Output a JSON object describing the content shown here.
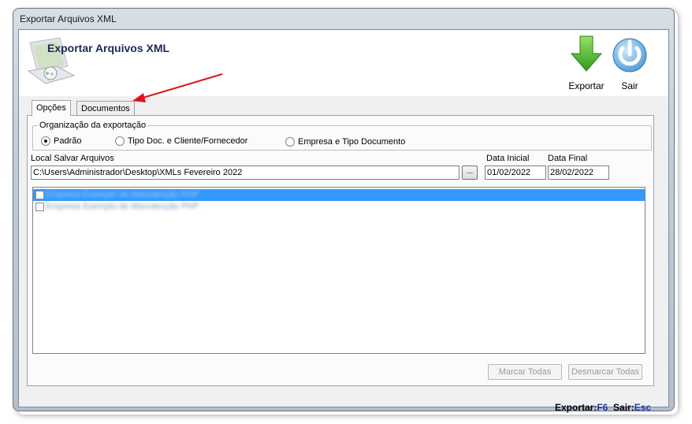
{
  "window": {
    "title": "Exportar Arquivos XML"
  },
  "header": {
    "title": "Exportar Arquivos XML"
  },
  "toolbar": {
    "export_label": "Exportar",
    "exit_label": "Sair"
  },
  "tabs": [
    {
      "label": "Opções"
    },
    {
      "label": "Documentos"
    }
  ],
  "organization": {
    "legend": "Organização da exportação",
    "options": [
      {
        "label": "Padrão",
        "selected": true
      },
      {
        "label": "Tipo Doc. e  Cliente/Fornecedor",
        "selected": false
      },
      {
        "label": "Empresa e Tipo Documento",
        "selected": false
      }
    ]
  },
  "save_path": {
    "label": "Local Salvar Arquivos",
    "value": "C:\\Users\\Administrador\\Desktop\\XMLs Fevereiro 2022",
    "browse_label": "..."
  },
  "date_start": {
    "label": "Data Inicial",
    "value": "01/02/2022"
  },
  "date_end": {
    "label": "Data Final",
    "value": "28/02/2022"
  },
  "companies": [
    {
      "name": "Empresa Exemplo de Manutenção PHP",
      "selected": true
    },
    {
      "name": "Empresa Exemplo de Manutenção PHP",
      "selected": false
    }
  ],
  "buttons": {
    "mark_all": "Marcar Todas",
    "unmark_all": "Desmarcar Todas"
  },
  "shortcuts": {
    "export_text": "Exportar:",
    "export_key": "F6",
    "exit_text": "Sair:",
    "exit_key": "Esc"
  },
  "colors": {
    "selection": "#3399ff",
    "annotation_arrow": "#e0141a",
    "shortcut_key": "#1f3aa8"
  }
}
